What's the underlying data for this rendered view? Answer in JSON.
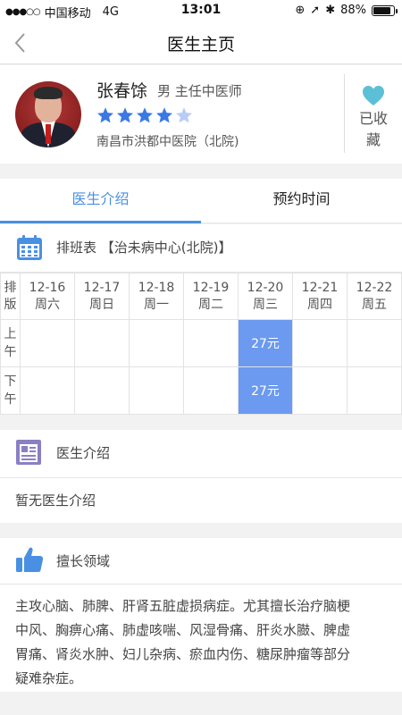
{
  "status_bar": {
    "carrier": "中国移动",
    "network": "4G",
    "time": "13:01",
    "battery": "88%"
  },
  "nav": {
    "title": "医生主页"
  },
  "doctor": {
    "name": "张春馀",
    "meta": "男 主任中医师",
    "rating": 4,
    "rating_max": 5,
    "hospital": "南昌市洪都中医院（北院)",
    "favorite_label": "已收藏"
  },
  "tabs": [
    {
      "label": "医生介绍",
      "active": true
    },
    {
      "label": "预约时间",
      "active": false
    }
  ],
  "schedule": {
    "title": "排班表 【治未病中心(北院)】",
    "corner_label": "排版",
    "columns": [
      {
        "date": "12-16",
        "weekday": "周六"
      },
      {
        "date": "12-17",
        "weekday": "周日"
      },
      {
        "date": "12-18",
        "weekday": "周一"
      },
      {
        "date": "12-19",
        "weekday": "周二"
      },
      {
        "date": "12-20",
        "weekday": "周三"
      },
      {
        "date": "12-21",
        "weekday": "周四"
      },
      {
        "date": "12-22",
        "weekday": "周五"
      }
    ],
    "rows": [
      {
        "label": "上午",
        "cells": [
          "",
          "",
          "",
          "",
          "27元",
          "",
          ""
        ]
      },
      {
        "label": "下午",
        "cells": [
          "",
          "",
          "",
          "",
          "27元",
          "",
          ""
        ]
      }
    ]
  },
  "intro": {
    "title": "医生介绍",
    "text": "暂无医生介绍"
  },
  "specialty": {
    "title": "擅长领域",
    "lines": [
      "主攻心脑、肺脾、肝肾五脏虚损病症。尤其擅长治疗脑梗",
      "中风、胸痹心痛、肺虚咳喘、风湿骨痛、肝炎水臌、脾虚",
      "胃痛、肾炎水肿、妇儿杂病、瘀血内伤、糖尿肿瘤等部分",
      "疑难杂症。"
    ]
  },
  "colors": {
    "accent": "#4a90e2",
    "slot_available": "#6b9af0",
    "star_filled": "#3a78e6",
    "star_empty": "#b8cdf5",
    "heart": "#5bc0d6"
  }
}
